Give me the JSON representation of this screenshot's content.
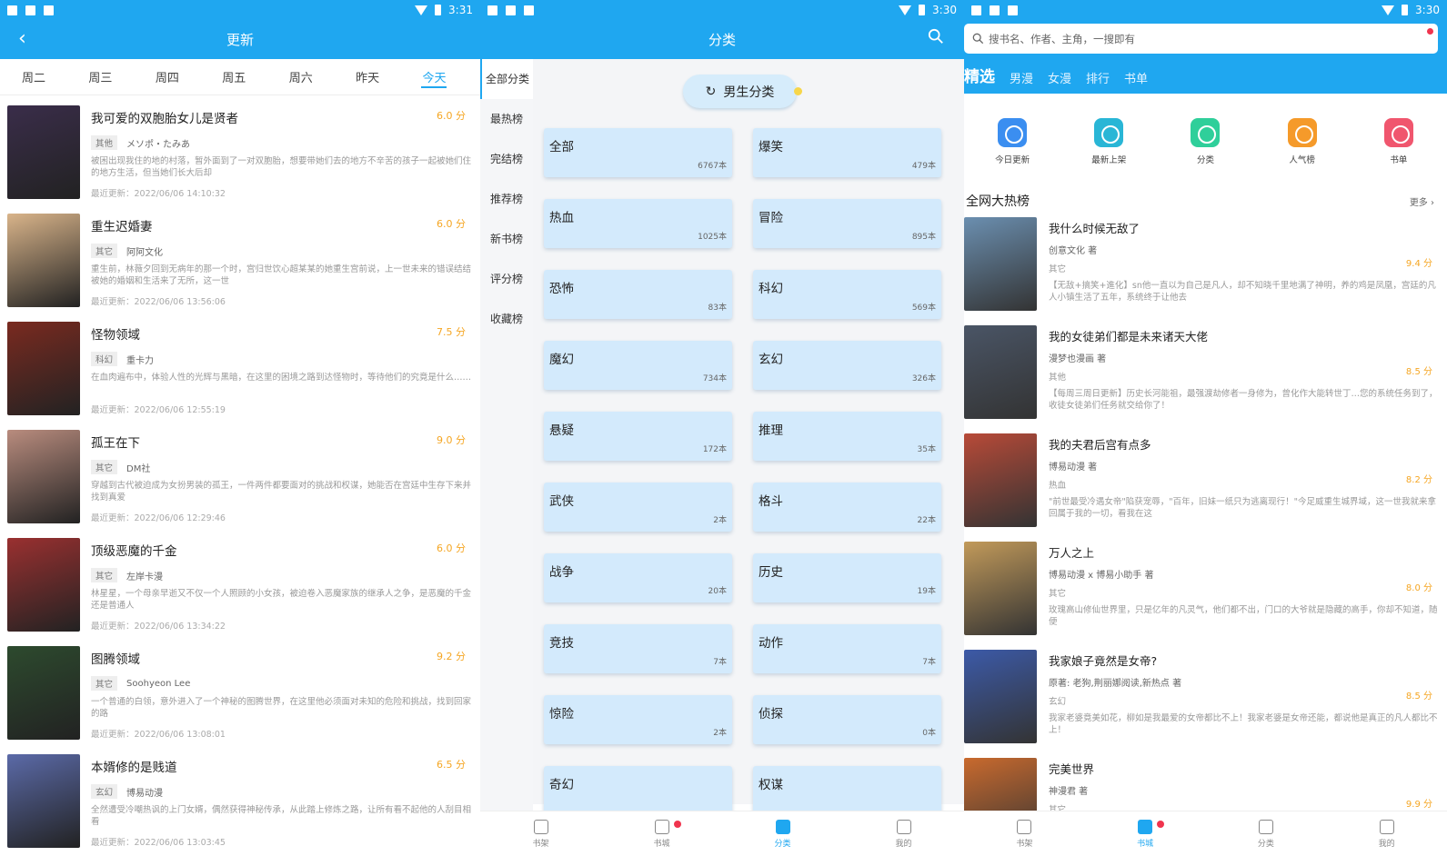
{
  "status": {
    "p1_time": "3:31",
    "p2_time": "3:30",
    "p3_time": "3:30"
  },
  "update": {
    "title": "更新",
    "days": [
      "周二",
      "周三",
      "周四",
      "周五",
      "周六",
      "昨天",
      "今天"
    ],
    "update_prefix": "最近更新：",
    "items": [
      {
        "title": "我可爱的双胞胎女儿是贤者",
        "score": "6.0 分",
        "tag": "其他",
        "author": "メソポ・たみあ",
        "desc": "被困出现我住的地的村落，暂外面到了一对双胞胎，想要带她们去的地方不辛苦的孩子一起被她们住的地方生活，但当她们长大后却",
        "date": "2022/06/06 14:10:32",
        "color": "#3a2d4a"
      },
      {
        "title": "重生迟婚妻",
        "score": "6.0 分",
        "tag": "其它",
        "author": "阿阿文化",
        "desc": "重生前，林薇夕回到无病年的那一个时，宫归世饮心超某某的她重生宫前说，上一世未来的错误结结被她的婚姻和生活来了无所，这一世",
        "date": "2022/06/06 13:56:06",
        "color": "#d9b48a"
      },
      {
        "title": "怪物领域",
        "score": "7.5 分",
        "tag": "科幻",
        "author": "重卡力",
        "desc": "在血肉遍布中，体验人性的光辉与黑暗，在这里的困境之路到达怪物时，等待他们的究竟是什么……",
        "date": "2022/06/06 12:55:19",
        "color": "#7a2a20"
      },
      {
        "title": "孤王在下",
        "score": "9.0 分",
        "tag": "其它",
        "author": "DM社",
        "desc": "穿越到古代被迫成为女扮男装的孤王，一件两件都要面对的挑战和权谋，她能否在宫廷中生存下来并找到真爱",
        "date": "2022/06/06 12:29:46",
        "color": "#b98c7e"
      },
      {
        "title": "顶级恶魔的千金",
        "score": "6.0 分",
        "tag": "其它",
        "author": "左岸卡漫",
        "desc": "林星星，一个母亲早逝又不仅一个人照顾的小女孩，被迫卷入恶魔家族的继承人之争，是恶魔的千金还是普通人",
        "date": "2022/06/06 13:34:22",
        "color": "#9a3030"
      },
      {
        "title": "图腾领域",
        "score": "9.2 分",
        "tag": "其它",
        "author": "Soohyeon Lee",
        "desc": "一个普通的白领，意外进入了一个神秘的图腾世界，在这里他必须面对未知的危险和挑战，找到回家的路",
        "date": "2022/06/06 13:08:01",
        "color": "#2d4a2e"
      },
      {
        "title": "本婿修的是贱道",
        "score": "6.5 分",
        "tag": "玄幻",
        "author": "博易动漫",
        "desc": "全然遭受冷嘲热讽的上门女婿，偶然获得神秘传承，从此踏上修炼之路，让所有看不起他的人刮目相看",
        "date": "2022/06/06 13:03:45",
        "color": "#5b6aa8"
      }
    ]
  },
  "category": {
    "title": "分类",
    "side": [
      "全部分类",
      "最热榜",
      "完结榜",
      "推荐榜",
      "新书榜",
      "评分榜",
      "收藏榜"
    ],
    "pill": "男生分类",
    "cats": [
      {
        "name": "全部",
        "count": "6767本"
      },
      {
        "name": "爆笑",
        "count": "479本"
      },
      {
        "name": "热血",
        "count": "1025本"
      },
      {
        "name": "冒险",
        "count": "895本"
      },
      {
        "name": "恐怖",
        "count": "83本"
      },
      {
        "name": "科幻",
        "count": "569本"
      },
      {
        "name": "魔幻",
        "count": "734本"
      },
      {
        "name": "玄幻",
        "count": "326本"
      },
      {
        "name": "悬疑",
        "count": "172本"
      },
      {
        "name": "推理",
        "count": "35本"
      },
      {
        "name": "武侠",
        "count": "2本"
      },
      {
        "name": "格斗",
        "count": "22本"
      },
      {
        "name": "战争",
        "count": "20本"
      },
      {
        "name": "历史",
        "count": "19本"
      },
      {
        "name": "竞技",
        "count": "7本"
      },
      {
        "name": "动作",
        "count": "7本"
      },
      {
        "name": "惊险",
        "count": "2本"
      },
      {
        "name": "侦探",
        "count": "0本"
      },
      {
        "name": "奇幻",
        "count": ""
      },
      {
        "name": "权谋",
        "count": ""
      }
    ],
    "nav": [
      "书架",
      "书城",
      "分类",
      "我的"
    ]
  },
  "home": {
    "search_placeholder": "搜书名、作者、主角，一搜即有",
    "tabs": [
      "精选",
      "男漫",
      "女漫",
      "排行",
      "书单"
    ],
    "quick": [
      {
        "label": "今日更新",
        "color": "#3b8ef0"
      },
      {
        "label": "最新上架",
        "color": "#29b6d6"
      },
      {
        "label": "分类",
        "color": "#2fcf9a"
      },
      {
        "label": "人气榜",
        "color": "#f59a2a"
      },
      {
        "label": "书单",
        "color": "#f0566e"
      }
    ],
    "section": "全网大热榜",
    "more": "更多",
    "author_suffix": " 著",
    "items": [
      {
        "title": "我什么时候无敌了",
        "author": "创意文化",
        "genre": "其它",
        "score": "9.4 分",
        "desc": "【无敌+搞笑+進化】sn他一直以为自己是凡人，却不知晓千里地满了神明，养的鸡是凤凰，宫廷的凡人小镇生活了五年，系统终于让他去",
        "color": "#6b8fb0"
      },
      {
        "title": "我的女徒弟们都是未来诸天大佬",
        "author": "漫梦也漫画",
        "genre": "其他",
        "score": "8.5 分",
        "desc": "【每周三周日更新】历史长河能祖，最强渡劫修者一身修为，曾化作大能转世丁…您的系统任务到了，收徒女徒弟们任务就交给你了！",
        "color": "#4a5566"
      },
      {
        "title": "我的夫君后宫有点多",
        "author": "博易动漫",
        "genre": "热血",
        "score": "8.2 分",
        "desc": "\"前世最受冷遇女帝\"陷获宠辱，\"百年，旧妹一纸只为逃离现行！\"今足威重生城界域，这一世我就来拿回属于我的一切，看我在这",
        "color": "#b84a38"
      },
      {
        "title": "万人之上",
        "author": "博易动漫 x 博易小助手",
        "genre": "其它",
        "score": "8.0 分",
        "desc": "玫瑰高山修仙世界里，只是亿年的凡灵气，他们都不出，门口的大爷就是隐藏的高手，你却不知道，随便",
        "color": "#c29a5a"
      },
      {
        "title": "我家娘子竟然是女帝?",
        "author": "原著: 老狗,荆丽娜阅读,新热点",
        "genre": "玄幻",
        "score": "8.5 分",
        "desc": "我家老婆竟美如花，柳如是我最爱的女帝都比不上！我家老婆是女帝还能，都说他是真正的凡人都比不上！",
        "color": "#3c5aa8"
      },
      {
        "title": "完美世界",
        "author": "神漫君",
        "genre": "其它",
        "score": "9.9 分",
        "desc": "",
        "color": "#c96a2e"
      }
    ],
    "nav": [
      "书架",
      "书城",
      "分类",
      "我的"
    ]
  }
}
